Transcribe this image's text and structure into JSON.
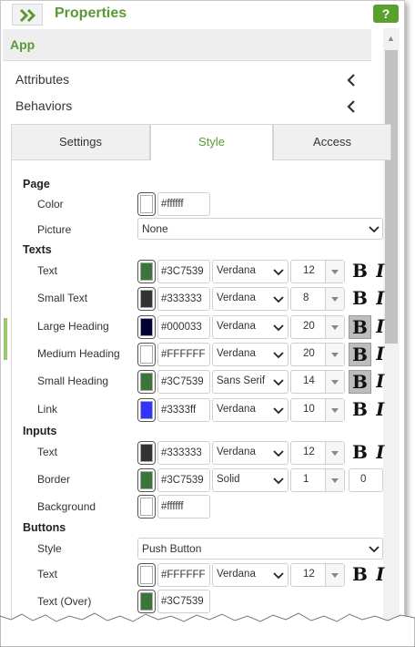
{
  "header": {
    "title": "Properties",
    "help_label": "?"
  },
  "app_bar": {
    "label": "App"
  },
  "accordion": [
    {
      "label": "Attributes"
    },
    {
      "label": "Behaviors"
    }
  ],
  "tabs": [
    {
      "label": "Settings"
    },
    {
      "label": "Style",
      "active": true
    },
    {
      "label": "Access"
    }
  ],
  "page": {
    "section": "Page",
    "color": {
      "label": "Color",
      "swatch": "#ffffff",
      "value": "#ffffff"
    },
    "picture": {
      "label": "Picture",
      "value": "None"
    }
  },
  "texts": {
    "section": "Texts",
    "rows": [
      {
        "label": "Text",
        "swatch": "#3C7539",
        "hex": "#3C7539",
        "font": "Verdana",
        "size": "12",
        "bold_active": false
      },
      {
        "label": "Small Text",
        "swatch": "#333333",
        "hex": "#333333",
        "font": "Verdana",
        "size": "8",
        "bold_active": false
      },
      {
        "label": "Large Heading",
        "swatch": "#000033",
        "hex": "#000033",
        "font": "Verdana",
        "size": "20",
        "bold_active": true
      },
      {
        "label": "Medium Heading",
        "swatch": "#FFFFFF",
        "hex": "#FFFFFF",
        "font": "Verdana",
        "size": "20",
        "bold_active": true
      },
      {
        "label": "Small Heading",
        "swatch": "#3C7539",
        "hex": "#3C7539",
        "font": "Sans Serif",
        "size": "14",
        "bold_active": true
      },
      {
        "label": "Link",
        "swatch": "#3333ff",
        "hex": "#3333ff",
        "font": "Verdana",
        "size": "10",
        "bold_active": false
      }
    ]
  },
  "inputs": {
    "section": "Inputs",
    "text": {
      "label": "Text",
      "swatch": "#333333",
      "hex": "#333333",
      "font": "Verdana",
      "size": "12"
    },
    "border": {
      "label": "Border",
      "swatch": "#3C7539",
      "hex": "#3C7539",
      "style": "Solid",
      "width": "1",
      "radius": "0"
    },
    "background": {
      "label": "Background",
      "swatch": "#ffffff",
      "hex": "#ffffff"
    }
  },
  "buttons": {
    "section": "Buttons",
    "style": {
      "label": "Style",
      "value": "Push Button"
    },
    "text": {
      "label": "Text",
      "swatch": "#FFFFFF",
      "hex": "#FFFFFF",
      "font": "Verdana",
      "size": "12"
    },
    "text_over": {
      "label": "Text (Over)",
      "swatch": "#3C7539",
      "hex": "#3C7539"
    }
  },
  "icons": {
    "bold": "B",
    "italic": "I"
  }
}
